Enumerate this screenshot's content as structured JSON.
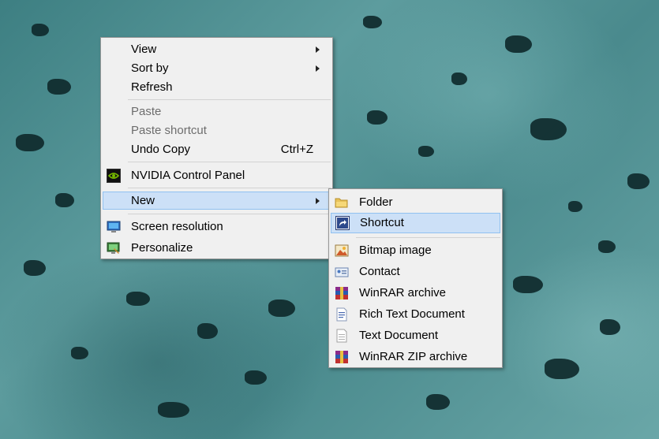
{
  "context_menu": {
    "view": "View",
    "sort_by": "Sort by",
    "refresh": "Refresh",
    "paste": "Paste",
    "paste_shortcut": "Paste shortcut",
    "undo_copy": "Undo Copy",
    "undo_copy_shortcut": "Ctrl+Z",
    "nvidia": "NVIDIA Control Panel",
    "new": "New",
    "screen_resolution": "Screen resolution",
    "personalize": "Personalize"
  },
  "new_submenu": {
    "folder": "Folder",
    "shortcut": "Shortcut",
    "bitmap": "Bitmap image",
    "contact": "Contact",
    "winrar_archive": "WinRAR archive",
    "rich_text": "Rich Text Document",
    "text_document": "Text Document",
    "winrar_zip": "WinRAR ZIP archive"
  },
  "icons": {
    "nvidia": "nvidia-icon",
    "screen_resolution": "monitor-icon",
    "personalize": "personalize-icon",
    "folder": "folder-icon",
    "shortcut": "shortcut-icon",
    "bitmap": "bitmap-icon",
    "contact": "contact-icon",
    "winrar": "winrar-icon",
    "rich_text": "rich-text-icon",
    "text": "text-document-icon"
  },
  "colors": {
    "highlight_fill": "#cce0f7",
    "highlight_border": "#90c1f0",
    "menu_background": "#f0f0f0",
    "disabled_text": "#6d6d6d"
  }
}
